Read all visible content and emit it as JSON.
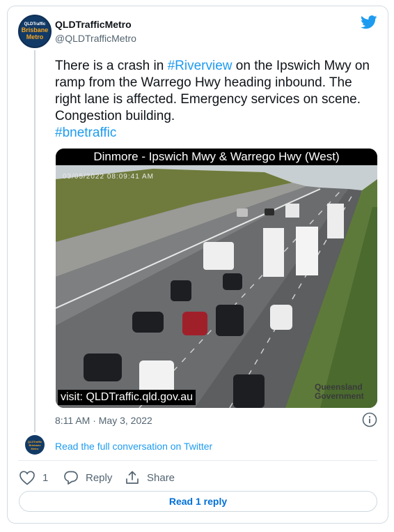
{
  "tweet": {
    "author": {
      "display_name": "QLDTrafficMetro",
      "handle": "@QLDTrafficMetro",
      "avatar_lines": [
        "QLDTraffic",
        "Brisbane",
        "Metro"
      ]
    },
    "text": {
      "part1": "There is a crash in ",
      "hashtag1": "#Riverview",
      "part2": " on the Ipswich Mwy on ramp from the Warrego Hwy heading inbound. The right lane is affected. Emergency services on scene.  Congestion building.",
      "hashtag2": "#bnetraffic"
    },
    "media": {
      "camera_title": "Dinmore - Ipswich Mwy & Warrego Hwy (West)",
      "camera_timestamp": "03/05/2022 08:09:41 AM",
      "visit_text": "visit: QLDTraffic.qld.gov.au",
      "gov_watermark_line1": "Queensland",
      "gov_watermark_line2": "Government"
    },
    "timestamp": "8:11 AM · May 3, 2022",
    "read_full_link": "Read the full conversation on Twitter",
    "actions": {
      "like_count": "1",
      "reply_label": "Reply",
      "share_label": "Share"
    },
    "read_reply_button": "Read 1 reply"
  },
  "colors": {
    "twitter_blue": "#1d9bf0",
    "text_primary": "#0f1419",
    "text_secondary": "#536471",
    "read_reply_text": "#006fd6"
  },
  "icons": [
    "twitter-bird-icon",
    "info-icon",
    "heart-icon",
    "reply-bubble-icon",
    "share-icon"
  ]
}
